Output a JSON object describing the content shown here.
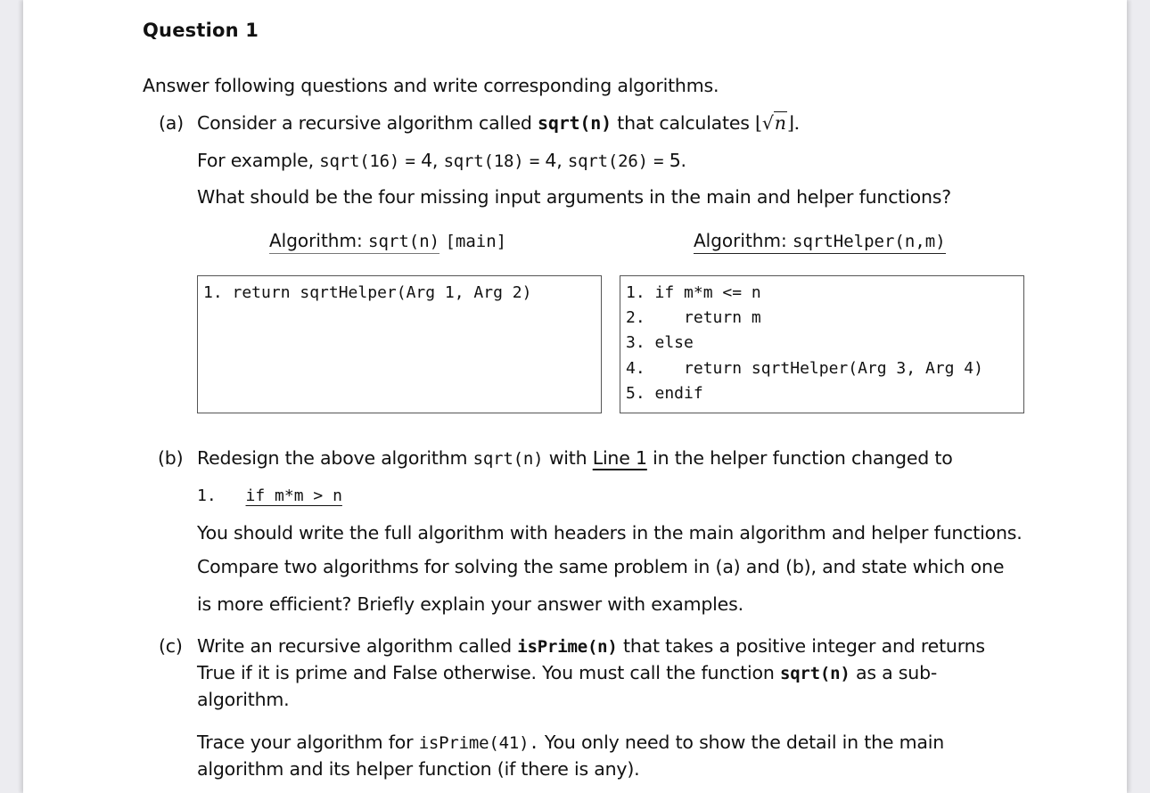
{
  "question": {
    "title": "Question 1",
    "intro": "Answer following questions and write corresponding algorithms."
  },
  "part_a": {
    "label": "(a)",
    "line1_prefix": "Consider a recursive algorithm called",
    "line1_func": "sqrt(n)",
    "line1_suffix": "that calculates",
    "floor_left": "⌊",
    "sqrt_symbol": "√",
    "sqrt_var": "n",
    "floor_right": "⌋.",
    "example_prefix": "For example,",
    "examples": [
      {
        "call": "sqrt(16)",
        "eq": "=",
        "result": "4,"
      },
      {
        "call": "sqrt(18)",
        "eq": "=",
        "result": "4,"
      },
      {
        "call": "sqrt(26)",
        "eq": "=",
        "result": "5."
      }
    ],
    "question_text": "What should be the four missing input arguments in the main and helper functions?",
    "main_algorithm": {
      "header_prefix": "Algorithm:",
      "header_name": "sqrt(n)",
      "header_tag": "[main]",
      "lines": [
        "1. return sqrtHelper(Arg 1, Arg 2)"
      ]
    },
    "helper_algorithm": {
      "header_prefix": "Algorithm:",
      "header_name": "sqrtHelper(n,m)",
      "lines": [
        "1. if m*m <= n",
        "2.    return m",
        "3. else",
        "4.    return sqrtHelper(Arg 3, Arg 4)",
        "5. endif"
      ]
    }
  },
  "part_b": {
    "label": "(b)",
    "line1_prefix": "Redesign the above algorithm",
    "line1_func": "sqrt(n)",
    "line1_with": "with",
    "line1_link": "Line 1",
    "line1_suffix": "in the helper function changed to",
    "changed_line_num": "1.",
    "changed_line_code": "if m*m > n",
    "para1": "You should write the full algorithm with headers in the main algorithm and helper functions.",
    "para2": "Compare two algorithms for solving the same problem in (a) and (b), and state which one",
    "para3": "is more efficient? Briefly explain your answer with examples."
  },
  "part_c": {
    "label": "(c)",
    "l1_prefix": "Write an recursive algorithm called",
    "l1_func": "isPrime(n)",
    "l1_suffix": "that takes a positive integer and returns",
    "l2_prefix": "True if it is prime and False otherwise.  You must call the function",
    "l2_func": "sqrt(n)",
    "l2_suffix": "as a sub-",
    "l3": "algorithm.",
    "trace_prefix": "Trace your algorithm for",
    "trace_func": "isPrime(41).",
    "trace_suffix": "You only need to show the detail in the main",
    "trace_l2": "algorithm and its helper function (if there is any)."
  }
}
